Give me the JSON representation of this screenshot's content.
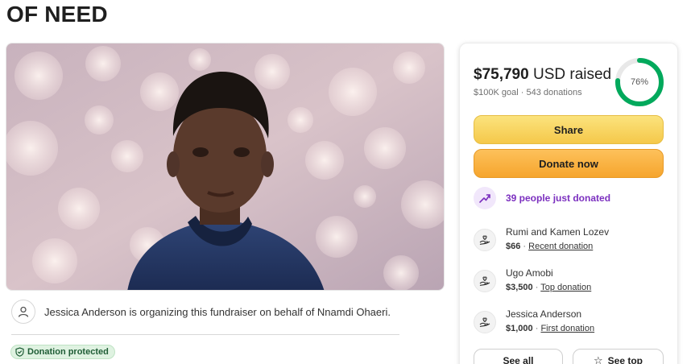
{
  "page": {
    "title": "OF NEED"
  },
  "organizer": {
    "text": "Jessica Anderson is organizing this fundraiser on behalf of Nnamdi Ohaeri."
  },
  "badge": {
    "label": "Donation protected"
  },
  "summary": {
    "raised_amount": "$75,790",
    "raised_suffix": " USD raised",
    "goal": "$100K goal",
    "donations": "543 donations",
    "progress_label": "76%",
    "progress_fraction": 0.76
  },
  "actions": {
    "share_label": "Share",
    "donate_label": "Donate now"
  },
  "activity": {
    "just_donated": "39 people just donated"
  },
  "donors": [
    {
      "name": "Rumi and Kamen Lozev",
      "amount": "$66",
      "tag": "Recent donation"
    },
    {
      "name": "Ugo Amobi",
      "amount": "$3,500",
      "tag": "Top donation"
    },
    {
      "name": "Jessica Anderson",
      "amount": "$1,000",
      "tag": "First donation"
    }
  ],
  "footer_buttons": {
    "see_all": "See all",
    "see_top": "See top"
  },
  "colors": {
    "progress_green": "#02a95c",
    "share_yellow": "#f5c84a",
    "donate_orange": "#f6a52d",
    "purple_accent": "#7b2fbf",
    "badge_green": "#1f5d36"
  }
}
